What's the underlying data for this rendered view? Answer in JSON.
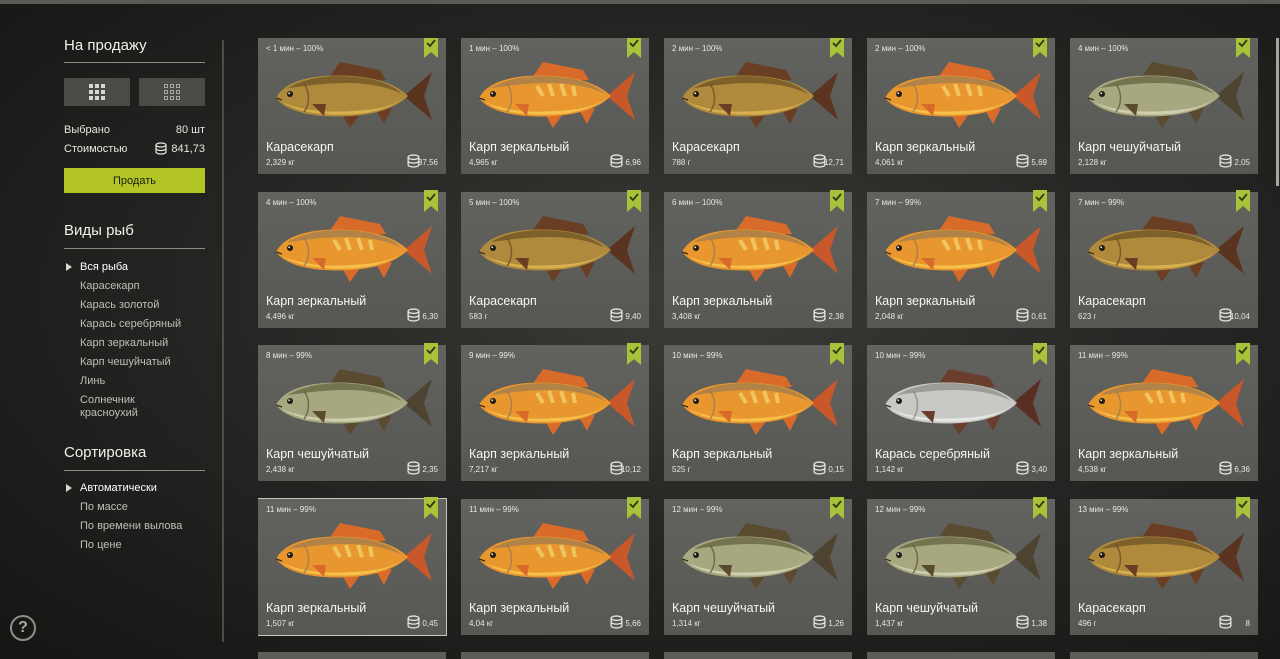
{
  "sidebar": {
    "sale_title": "На продажу",
    "selected_label": "Выбрано",
    "selected_value": "80 шт",
    "cost_label": "Стоимостью",
    "cost_value": "841,73",
    "sell_button": "Продать",
    "fish_types_title": "Виды рыб",
    "fish_types": [
      {
        "label": "Вся рыба",
        "active": true
      },
      {
        "label": "Карасекарп",
        "active": false
      },
      {
        "label": "Карась золотой",
        "active": false
      },
      {
        "label": "Карась серебряный",
        "active": false
      },
      {
        "label": "Карп зеркальный",
        "active": false
      },
      {
        "label": "Карп чешуйчатый",
        "active": false
      },
      {
        "label": "Линь",
        "active": false
      },
      {
        "label": "Солнечник красноухий",
        "active": false
      }
    ],
    "sort_title": "Сортировка",
    "sort_options": [
      {
        "label": "Автоматически",
        "active": true
      },
      {
        "label": "По массе",
        "active": false
      },
      {
        "label": "По времени вылова",
        "active": false
      },
      {
        "label": "По цене",
        "active": false
      }
    ],
    "help_label": "?"
  },
  "colors": {
    "accent": "#b3c525",
    "card": "#5c5c58",
    "flag": "#a8c23a",
    "mirror_carp": "#e8962e",
    "crucian_carp": "#b08a3c",
    "common_carp": "#a8a880",
    "silver_crucian": "#c8c8c4"
  },
  "cards": [
    {
      "time": "< 1 мин – 100%",
      "name": "Карасекарп",
      "weight": "2,329 кг",
      "price": "37,56",
      "fish": "crucian-carp",
      "selected": false
    },
    {
      "time": "1 мин – 100%",
      "name": "Карп зеркальный",
      "weight": "4,965 кг",
      "price": "6,96",
      "fish": "mirror-carp",
      "selected": false
    },
    {
      "time": "2 мин – 100%",
      "name": "Карасекарп",
      "weight": "788 г",
      "price": "12,71",
      "fish": "crucian-carp",
      "selected": false
    },
    {
      "time": "2 мин – 100%",
      "name": "Карп зеркальный",
      "weight": "4,061 кг",
      "price": "5,69",
      "fish": "mirror-carp",
      "selected": false
    },
    {
      "time": "4 мин – 100%",
      "name": "Карп чешуйчатый",
      "weight": "2,128 кг",
      "price": "2,05",
      "fish": "common-carp",
      "selected": false
    },
    {
      "time": "4 мин – 100%",
      "name": "Карп зеркальный",
      "weight": "4,496 кг",
      "price": "6,30",
      "fish": "mirror-carp",
      "selected": false
    },
    {
      "time": "5 мин – 100%",
      "name": "Карасекарп",
      "weight": "583 г",
      "price": "9,40",
      "fish": "crucian-carp",
      "selected": false
    },
    {
      "time": "6 мин – 100%",
      "name": "Карп зеркальный",
      "weight": "3,408 кг",
      "price": "2,38",
      "fish": "mirror-carp",
      "selected": false
    },
    {
      "time": "7 мин – 99%",
      "name": "Карп зеркальный",
      "weight": "2,048 кг",
      "price": "0,61",
      "fish": "mirror-carp",
      "selected": false
    },
    {
      "time": "7 мин – 99%",
      "name": "Карасекарп",
      "weight": "623 г",
      "price": "10,04",
      "fish": "crucian-carp",
      "selected": false
    },
    {
      "time": "8 мин – 99%",
      "name": "Карп чешуйчатый",
      "weight": "2,438 кг",
      "price": "2,35",
      "fish": "common-carp",
      "selected": false
    },
    {
      "time": "9 мин – 99%",
      "name": "Карп зеркальный",
      "weight": "7,217 кг",
      "price": "10,12",
      "fish": "mirror-carp",
      "selected": false
    },
    {
      "time": "10 мин – 99%",
      "name": "Карп зеркальный",
      "weight": "525 г",
      "price": "0,15",
      "fish": "mirror-carp",
      "selected": false
    },
    {
      "time": "10 мин – 99%",
      "name": "Карась серебряный",
      "weight": "1,142 кг",
      "price": "3,40",
      "fish": "silver-crucian",
      "selected": false
    },
    {
      "time": "11 мин – 99%",
      "name": "Карп зеркальный",
      "weight": "4,538 кг",
      "price": "6,36",
      "fish": "mirror-carp",
      "selected": false
    },
    {
      "time": "11 мин – 99%",
      "name": "Карп зеркальный",
      "weight": "1,507 кг",
      "price": "0,45",
      "fish": "mirror-carp",
      "selected": true
    },
    {
      "time": "11 мин – 99%",
      "name": "Карп зеркальный",
      "weight": "4,04 кг",
      "price": "5,66",
      "fish": "mirror-carp",
      "selected": false
    },
    {
      "time": "12 мин – 99%",
      "name": "Карп чешуйчатый",
      "weight": "1,314 кг",
      "price": "1,26",
      "fish": "common-carp",
      "selected": false
    },
    {
      "time": "12 мин – 99%",
      "name": "Карп чешуйчатый",
      "weight": "1,437 кг",
      "price": "1,38",
      "fish": "common-carp",
      "selected": false
    },
    {
      "time": "13 мин – 99%",
      "name": "Карасекарп",
      "weight": "496 г",
      "price": "8",
      "fish": "crucian-carp",
      "selected": false
    }
  ]
}
